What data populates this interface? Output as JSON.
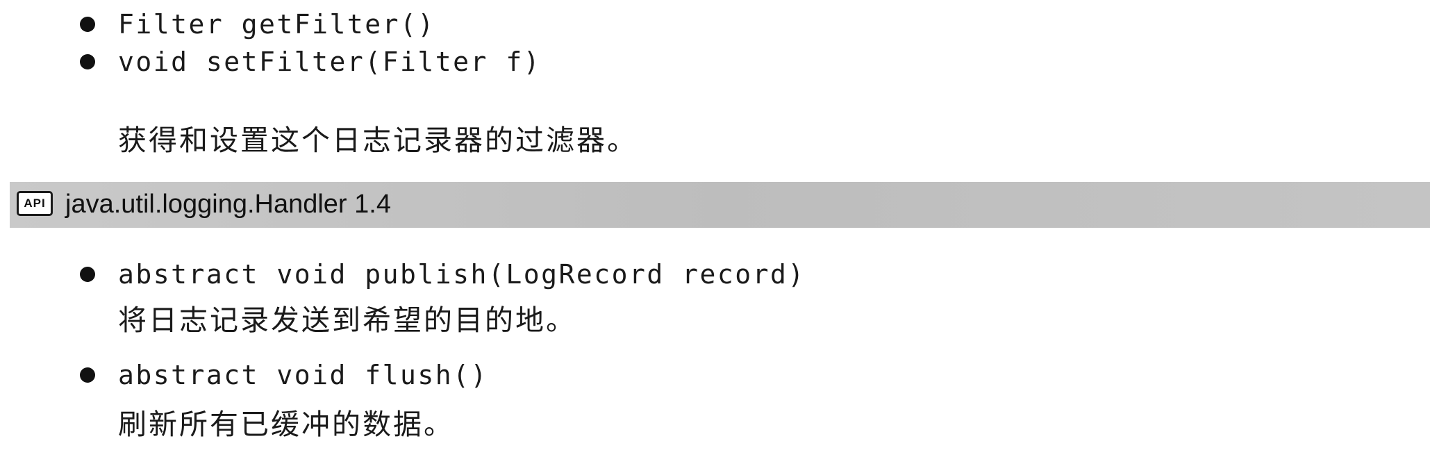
{
  "filter_section": {
    "items": [
      {
        "signature": "Filter getFilter()"
      },
      {
        "signature": "void setFilter(Filter f)"
      }
    ],
    "description": "获得和设置这个日志记录器的过滤器。"
  },
  "api_header": {
    "icon_label": "API",
    "title": "java.util.logging.Handler 1.4"
  },
  "handler_section": {
    "items": [
      {
        "signature": "abstract void publish(LogRecord record)",
        "description": "将日志记录发送到希望的目的地。"
      },
      {
        "signature": "abstract void flush()",
        "description": "刷新所有已缓冲的数据。"
      }
    ]
  }
}
